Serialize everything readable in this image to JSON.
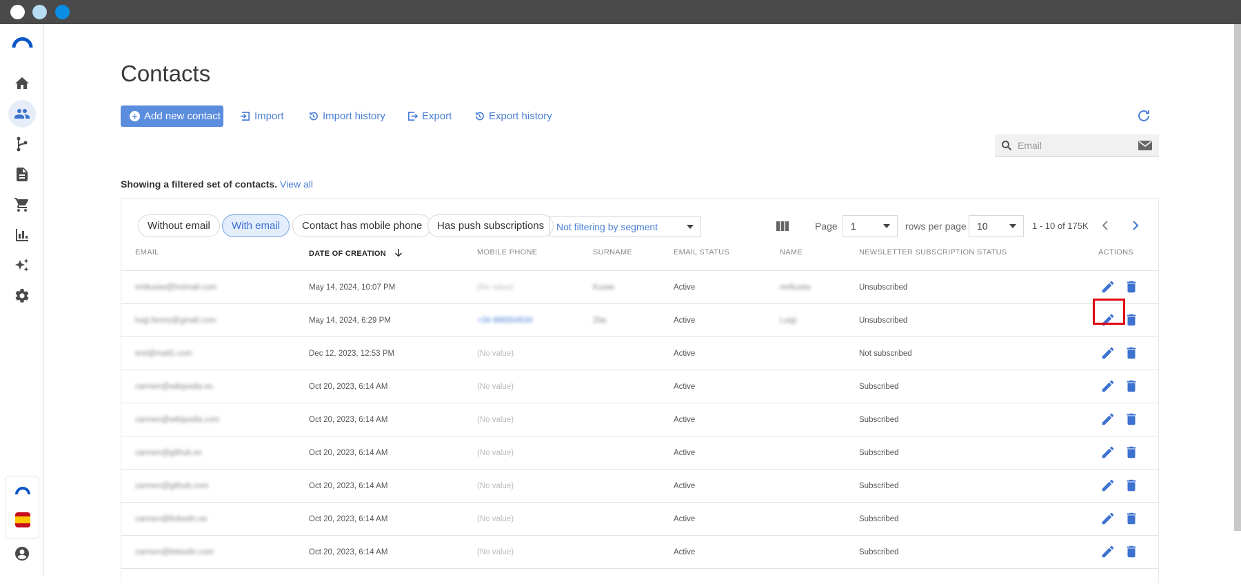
{
  "window": {
    "dots": [
      {
        "name": "window-dot-close",
        "color": "#ffffff"
      },
      {
        "name": "window-dot-minimize",
        "color": "#b8dcf5"
      },
      {
        "name": "window-dot-maximize",
        "color": "#0a8fe6"
      }
    ]
  },
  "sidebar": {
    "items": [
      {
        "name": "sidebar-item-home",
        "icon": "home-icon"
      },
      {
        "name": "sidebar-item-contacts",
        "icon": "contacts-icon",
        "active": true
      },
      {
        "name": "sidebar-item-flows",
        "icon": "flow-branch-icon"
      },
      {
        "name": "sidebar-item-templates",
        "icon": "document-icon"
      },
      {
        "name": "sidebar-item-ecommerce",
        "icon": "cart-icon"
      },
      {
        "name": "sidebar-item-reports",
        "icon": "bar-chart-icon"
      },
      {
        "name": "sidebar-item-ai",
        "icon": "sparkle-icon"
      },
      {
        "name": "sidebar-item-settings",
        "icon": "gear-icon"
      }
    ],
    "bottom": [
      "brand-small-icon",
      "spain-flag-icon",
      "account-icon"
    ]
  },
  "page": {
    "title": "Contacts",
    "add_button": "Add new contact",
    "import": "Import",
    "import_history": "Import history",
    "export": "Export",
    "export_history": "Export history",
    "search_placeholder": "Email",
    "filter_note": "Showing a filtered set of contacts.",
    "view_all": "View all"
  },
  "filters": {
    "chips": [
      {
        "label": "Without email",
        "active": false
      },
      {
        "label": "With email",
        "active": true
      },
      {
        "label": "Contact has mobile phone",
        "active": false
      },
      {
        "label": "Has push subscriptions",
        "active": false
      }
    ],
    "segment": "Not filtering by segment"
  },
  "pagination": {
    "page_label": "Page",
    "page_value": "1",
    "rows_label": "rows per page",
    "rows_value": "10",
    "range": "1 - 10 of 175K"
  },
  "table": {
    "columns": [
      "Email",
      "Date of creation",
      "Mobile phone",
      "Surname",
      "Email status",
      "Name",
      "Newsletter subscription status",
      "Actions"
    ],
    "rows": [
      {
        "email": "mrikusiw@hotmail.com",
        "date": "May 14, 2024, 10:07 PM",
        "phone": "(No value)",
        "surname": "Kusiw",
        "status": "Active",
        "name": "mrikusiw",
        "newsletter": "Unsubscribed"
      },
      {
        "email": "luigi.ferery@gmail.com",
        "date": "May 14, 2024, 6:29 PM",
        "phone": "+34 686554634",
        "surname": "Zita",
        "status": "Active",
        "name": "Luigi",
        "newsletter": "Unsubscribed"
      },
      {
        "email": "test@mail1.com",
        "date": "Dec 12, 2023, 12:53 PM",
        "phone": "(No value)",
        "surname": "",
        "status": "Active",
        "name": "",
        "newsletter": "Not subscribed"
      },
      {
        "email": "carmen@wikipedia.es",
        "date": "Oct 20, 2023, 6:14 AM",
        "phone": "(No value)",
        "surname": "",
        "status": "Active",
        "name": "",
        "newsletter": "Subscribed"
      },
      {
        "email": "carmen@wikipedia.com",
        "date": "Oct 20, 2023, 6:14 AM",
        "phone": "(No value)",
        "surname": "",
        "status": "Active",
        "name": "",
        "newsletter": "Subscribed"
      },
      {
        "email": "carmen@github.es",
        "date": "Oct 20, 2023, 6:14 AM",
        "phone": "(No value)",
        "surname": "",
        "status": "Active",
        "name": "",
        "newsletter": "Subscribed"
      },
      {
        "email": "carmen@github.com",
        "date": "Oct 20, 2023, 6:14 AM",
        "phone": "(No value)",
        "surname": "",
        "status": "Active",
        "name": "",
        "newsletter": "Subscribed"
      },
      {
        "email": "carmen@linkedin.es",
        "date": "Oct 20, 2023, 6:14 AM",
        "phone": "(No value)",
        "surname": "",
        "status": "Active",
        "name": "",
        "newsletter": "Subscribed"
      },
      {
        "email": "carmen@linkedin.com",
        "date": "Oct 20, 2023, 6:14 AM",
        "phone": "(No value)",
        "surname": "",
        "status": "Active",
        "name": "",
        "newsletter": "Subscribed"
      }
    ]
  },
  "colors": {
    "accent": "#4a7fd6",
    "primary_button": "#5b8dde",
    "highlight": "#e00010"
  }
}
